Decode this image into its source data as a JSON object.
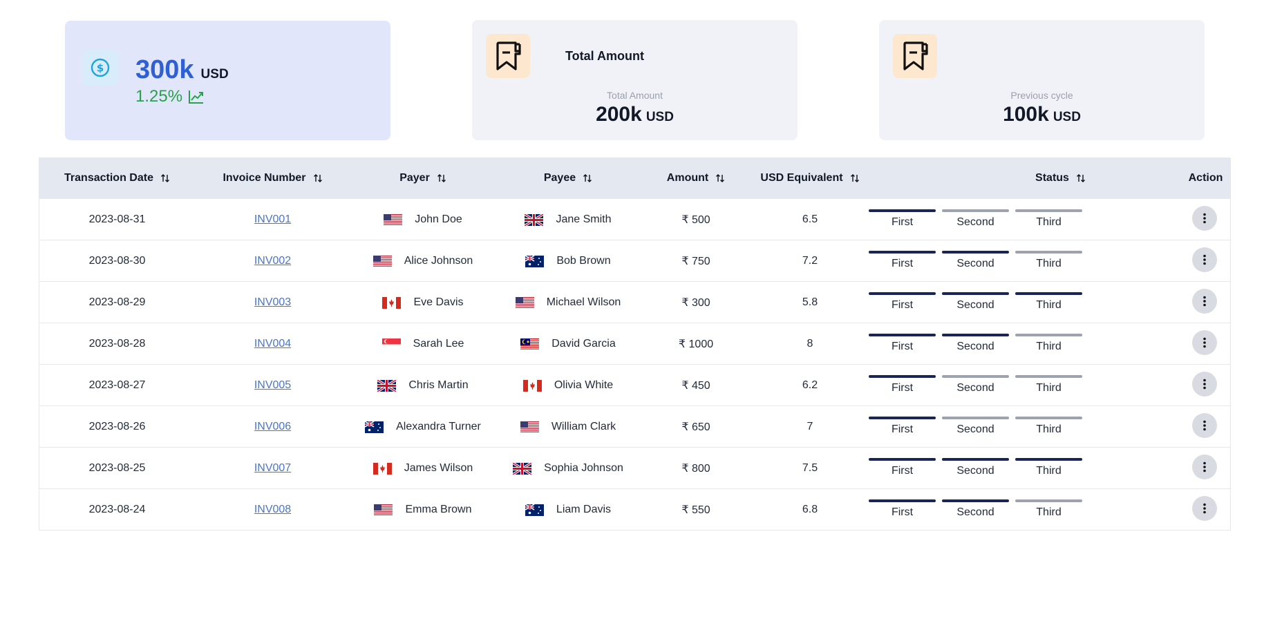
{
  "cards": {
    "primary": {
      "value": "300k",
      "currency": "USD",
      "growth": "1.25%",
      "icon": "dollar-circle-icon",
      "trend_icon": "trend-up-icon"
    },
    "total": {
      "title": "Total Amount",
      "subtitle": "Total Amount",
      "value": "200k",
      "currency": "USD",
      "icon": "receipt-icon"
    },
    "previous": {
      "subtitle": "Previous cycle",
      "value": "100k",
      "currency": "USD",
      "icon": "receipt-icon"
    }
  },
  "table": {
    "columns": [
      "Transaction Date",
      "Invoice Number",
      "Payer",
      "Payee",
      "Amount",
      "USD Equivalent",
      "Status",
      "Action"
    ],
    "step_labels": [
      "First",
      "Second",
      "Third"
    ],
    "rows": [
      {
        "date": "2023-08-31",
        "invoice": "INV001",
        "payer": "John Doe",
        "payer_flag": "us",
        "payee": "Jane Smith",
        "payee_flag": "gb",
        "amount": "₹ 500",
        "usd": "6.5",
        "progress": 1
      },
      {
        "date": "2023-08-30",
        "invoice": "INV002",
        "payer": "Alice Johnson",
        "payer_flag": "us",
        "payee": "Bob Brown",
        "payee_flag": "au",
        "amount": "₹ 750",
        "usd": "7.2",
        "progress": 2
      },
      {
        "date": "2023-08-29",
        "invoice": "INV003",
        "payer": "Eve Davis",
        "payer_flag": "ca",
        "payee": "Michael Wilson",
        "payee_flag": "us",
        "amount": "₹ 300",
        "usd": "5.8",
        "progress": 3
      },
      {
        "date": "2023-08-28",
        "invoice": "INV004",
        "payer": "Sarah Lee",
        "payer_flag": "sg",
        "payee": "David Garcia",
        "payee_flag": "my",
        "amount": "₹ 1000",
        "usd": "8",
        "progress": 2
      },
      {
        "date": "2023-08-27",
        "invoice": "INV005",
        "payer": "Chris Martin",
        "payer_flag": "gb",
        "payee": "Olivia White",
        "payee_flag": "ca",
        "amount": "₹ 450",
        "usd": "6.2",
        "progress": 1
      },
      {
        "date": "2023-08-26",
        "invoice": "INV006",
        "payer": "Alexandra Turner",
        "payer_flag": "au",
        "payee": "William Clark",
        "payee_flag": "us",
        "amount": "₹ 650",
        "usd": "7",
        "progress": 1
      },
      {
        "date": "2023-08-25",
        "invoice": "INV007",
        "payer": "James Wilson",
        "payer_flag": "ca",
        "payee": "Sophia Johnson",
        "payee_flag": "gb",
        "amount": "₹ 800",
        "usd": "7.5",
        "progress": 3
      },
      {
        "date": "2023-08-24",
        "invoice": "INV008",
        "payer": "Emma Brown",
        "payer_flag": "us",
        "payee": "Liam Davis",
        "payee_flag": "au",
        "amount": "₹ 550",
        "usd": "6.8",
        "progress": 2
      }
    ]
  },
  "colors": {
    "accent_blue": "#2f5fd3",
    "growth_green": "#27a14a",
    "step_done": "#1b2555",
    "step_pending": "#9ca3af",
    "link": "#4a74c9"
  }
}
